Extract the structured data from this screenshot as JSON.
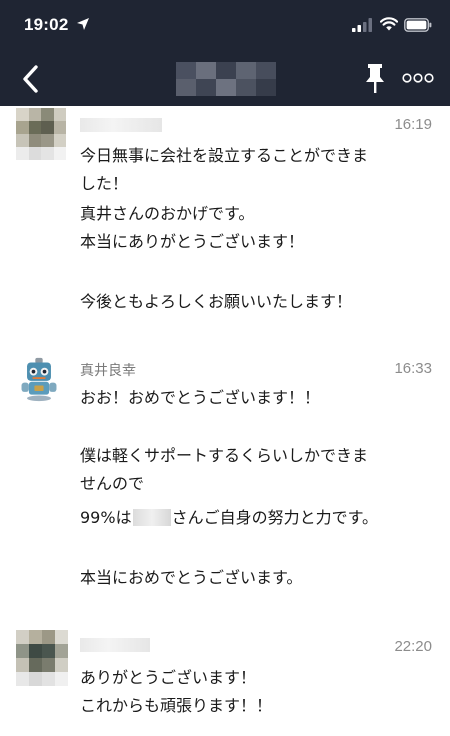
{
  "status_bar": {
    "time": "19:02"
  },
  "header": {
    "title_hidden": true
  },
  "messages": [
    {
      "sender": "",
      "time": "16:19",
      "lines": [
        "今日無事に会社を設立することができま",
        "した！",
        "真井さんのおかげです。",
        "本当にありがとうございます！",
        "",
        "今後ともよろしくお願いいたします！"
      ]
    },
    {
      "sender": "真井良幸",
      "time": "16:33",
      "lines": [
        "おお！おめでとうございます！！",
        "",
        "僕は軽くサポートするくらいしかできま",
        "せんので",
        "さんご自身の努力と力です。",
        "",
        "本当におめでとうございます。"
      ],
      "percent_prefix": "99%は"
    },
    {
      "sender": "",
      "time": "22:20",
      "lines": [
        "ありがとうございます！",
        "これからも頑張ります！！"
      ]
    }
  ],
  "icons": {
    "location": "location-arrow-icon",
    "signal": "cellular-signal-icon",
    "wifi": "wifi-icon",
    "battery": "battery-icon",
    "back": "chevron-left-icon",
    "pin": "pin-icon",
    "more": "more-options-icon",
    "robot": "robot-avatar-icon"
  },
  "colors": {
    "header_bg": "#1f2533",
    "text": "#1a1a1a",
    "timestamp": "#8c8c8c",
    "sender": "#7a7a7a"
  }
}
